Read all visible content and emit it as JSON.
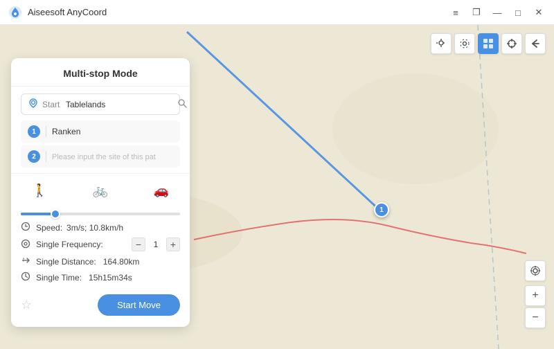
{
  "titlebar": {
    "title": "Aiseesoft AnyCoord",
    "logo_color": "#4a90e2"
  },
  "controls": {
    "minimize": "—",
    "maximize": "□",
    "restore": "❐",
    "close": "✕",
    "menu": "≡"
  },
  "panel": {
    "title": "Multi-stop Mode",
    "start_label": "Start",
    "start_value": "Tablelands",
    "start_placeholder": "Search location",
    "waypoints": [
      {
        "num": "1",
        "value": "Ranken",
        "placeholder": ""
      },
      {
        "num": "2",
        "value": "",
        "placeholder": "Please input the site of this pat"
      }
    ],
    "transport_modes": [
      "🚶",
      "🚲",
      "🚗"
    ],
    "active_mode": 0,
    "speed_label": "Speed:",
    "speed_value": "3m/s; 10.8km/h",
    "freq_label": "Single Frequency:",
    "freq_value": "1",
    "distance_label": "Single Distance:",
    "distance_value": "164.80km",
    "time_label": "Single Time:",
    "time_value": "15h15m34s",
    "start_move_label": "Start Move",
    "favorite_icon": "☆"
  },
  "map_toolbar": {
    "buttons": [
      {
        "icon": "📍",
        "label": "location",
        "active": false
      },
      {
        "icon": "⚙",
        "label": "settings",
        "active": false
      },
      {
        "icon": "🗺",
        "label": "map-mode",
        "active": true
      },
      {
        "icon": "✛",
        "label": "crosshair",
        "active": false
      },
      {
        "icon": "↩",
        "label": "back",
        "active": false
      }
    ]
  },
  "map_zoom": {
    "plus": "+",
    "minus": "−"
  },
  "map_marker": {
    "label": "1"
  }
}
